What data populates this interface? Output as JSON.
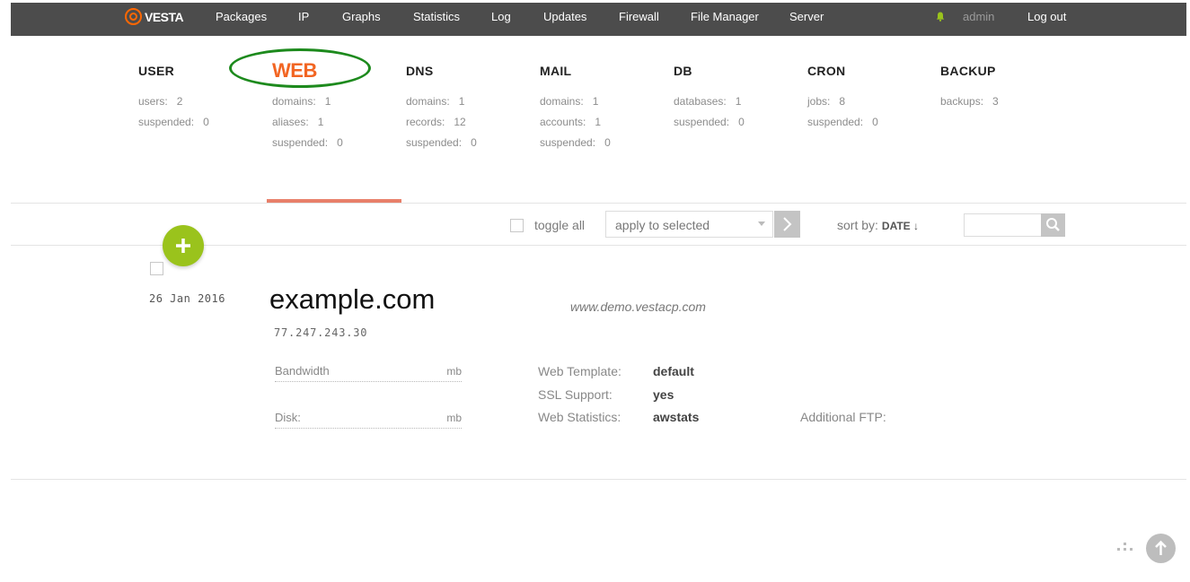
{
  "topbar": {
    "logo_text": "VESTA",
    "nav": [
      "Packages",
      "IP",
      "Graphs",
      "Statistics",
      "Log",
      "Updates",
      "Firewall",
      "File Manager",
      "Server"
    ],
    "user": "admin",
    "logout": "Log out"
  },
  "sections": {
    "user": {
      "title": "USER",
      "stats": [
        {
          "label": "users:",
          "value": "2"
        },
        {
          "label": "suspended:",
          "value": "0"
        }
      ]
    },
    "web": {
      "title": "WEB",
      "stats": [
        {
          "label": "domains:",
          "value": "1"
        },
        {
          "label": "aliases:",
          "value": "1"
        },
        {
          "label": "suspended:",
          "value": "0"
        }
      ]
    },
    "dns": {
      "title": "DNS",
      "stats": [
        {
          "label": "domains:",
          "value": "1"
        },
        {
          "label": "records:",
          "value": "12"
        },
        {
          "label": "suspended:",
          "value": "0"
        }
      ]
    },
    "mail": {
      "title": "MAIL",
      "stats": [
        {
          "label": "domains:",
          "value": "1"
        },
        {
          "label": "accounts:",
          "value": "1"
        },
        {
          "label": "suspended:",
          "value": "0"
        }
      ]
    },
    "db": {
      "title": "DB",
      "stats": [
        {
          "label": "databases:",
          "value": "1"
        },
        {
          "label": "suspended:",
          "value": "0"
        }
      ]
    },
    "cron": {
      "title": "CRON",
      "stats": [
        {
          "label": "jobs:",
          "value": "8"
        },
        {
          "label": "suspended:",
          "value": "0"
        }
      ]
    },
    "backup": {
      "title": "BACKUP",
      "stats": [
        {
          "label": "backups:",
          "value": "3"
        }
      ]
    }
  },
  "toolbar": {
    "toggle_all": "toggle all",
    "apply_placeholder": "apply to selected",
    "sort_by": "sort by:",
    "sort_field": "DATE ↓"
  },
  "row": {
    "date": "26 Jan 2016",
    "domain": "example.com",
    "alias": "www.demo.vestacp.com",
    "ip": "77.247.243.30",
    "bandwidth_label": "Bandwidth",
    "bandwidth_unit": "mb",
    "disk_label": "Disk:",
    "disk_unit": "mb",
    "web_template_label": "Web Template:",
    "web_template_value": "default",
    "ssl_label": "SSL Support:",
    "ssl_value": "yes",
    "web_stats_label": "Web Statistics:",
    "web_stats_value": "awstats",
    "ftp_label": "Additional FTP:"
  },
  "colors": {
    "topbar": "#4c4c4c",
    "accent": "#f26522",
    "add_button": "#9ac31c",
    "annotation_oval": "#1d8a1d"
  }
}
